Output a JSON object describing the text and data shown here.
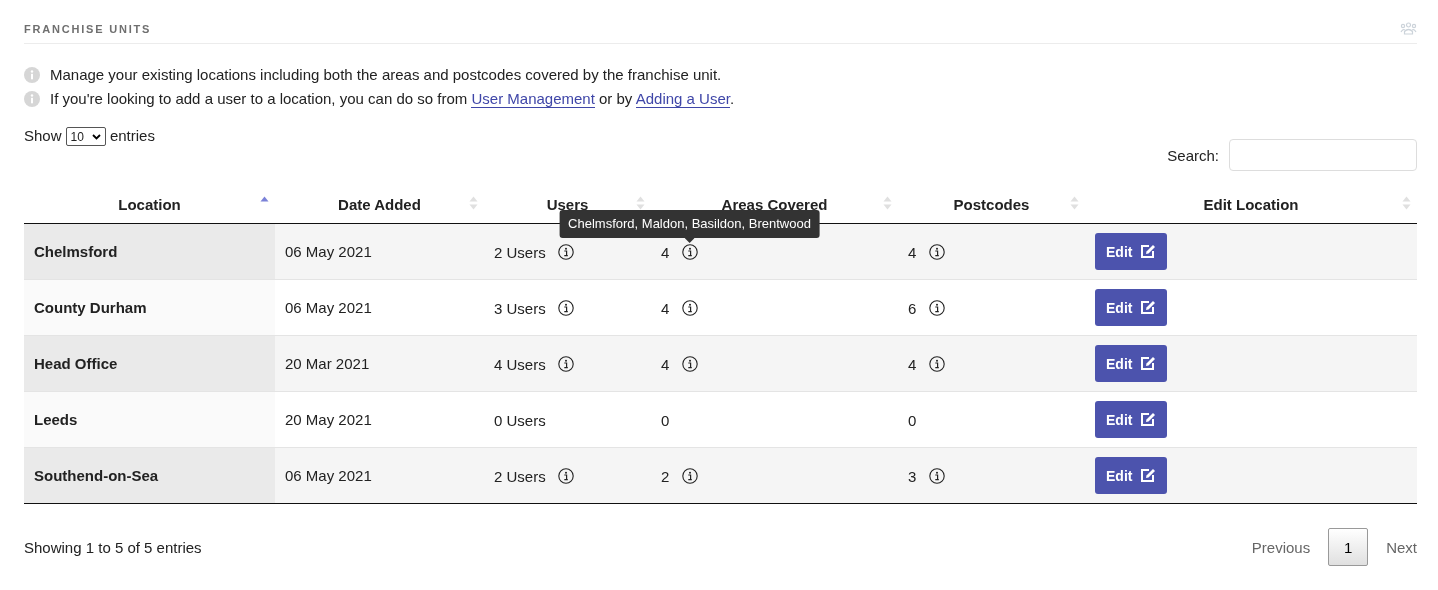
{
  "section": {
    "title": "FRANCHISE UNITS"
  },
  "notes": [
    {
      "text": "Manage your existing locations including both the areas and postcodes covered by the franchise unit."
    },
    {
      "text": "If you're looking to add a user to a location, you can do so from ",
      "links": [
        "User Management",
        "Adding a User"
      ],
      "between": " or by ",
      "after": "."
    }
  ],
  "length": {
    "before": "Show",
    "value": "10",
    "after": "entries"
  },
  "search": {
    "label": "Search:"
  },
  "table": {
    "columns": [
      {
        "label": "Location",
        "sorted": true
      },
      {
        "label": "Date Added",
        "sorted": false
      },
      {
        "label": "Users",
        "sorted": false
      },
      {
        "label": "Areas Covered",
        "sorted": false
      },
      {
        "label": "Postcodes",
        "sorted": false
      },
      {
        "label": "Edit Location",
        "sorted": false
      }
    ],
    "rows": [
      {
        "location": "Chelmsford",
        "date": "06 May 2021",
        "users": {
          "text": "2 Users",
          "info": true
        },
        "areas": {
          "text": "4",
          "info": true,
          "tooltip": "Chelmsford, Maldon, Basildon, Brentwood"
        },
        "postcodes": {
          "text": "4",
          "info": true
        },
        "edit": "Edit"
      },
      {
        "location": "County Durham",
        "date": "06 May 2021",
        "users": {
          "text": "3 Users",
          "info": true
        },
        "areas": {
          "text": "4",
          "info": true
        },
        "postcodes": {
          "text": "6",
          "info": true
        },
        "edit": "Edit"
      },
      {
        "location": "Head Office",
        "date": "20 Mar 2021",
        "users": {
          "text": "4 Users",
          "info": true
        },
        "areas": {
          "text": "4",
          "info": true
        },
        "postcodes": {
          "text": "4",
          "info": true
        },
        "edit": "Edit"
      },
      {
        "location": "Leeds",
        "date": "20 May 2021",
        "users": {
          "text": "0 Users",
          "info": false
        },
        "areas": {
          "text": "0",
          "info": false
        },
        "postcodes": {
          "text": "0",
          "info": false
        },
        "edit": "Edit"
      },
      {
        "location": "Southend-on-Sea",
        "date": "06 May 2021",
        "users": {
          "text": "2 Users",
          "info": true
        },
        "areas": {
          "text": "2",
          "info": true
        },
        "postcodes": {
          "text": "3",
          "info": true
        },
        "edit": "Edit"
      }
    ]
  },
  "footer": {
    "info": "Showing 1 to 5 of 5 entries",
    "previous": "Previous",
    "pages": [
      {
        "label": "1",
        "selected": true
      }
    ],
    "next": "Next"
  }
}
